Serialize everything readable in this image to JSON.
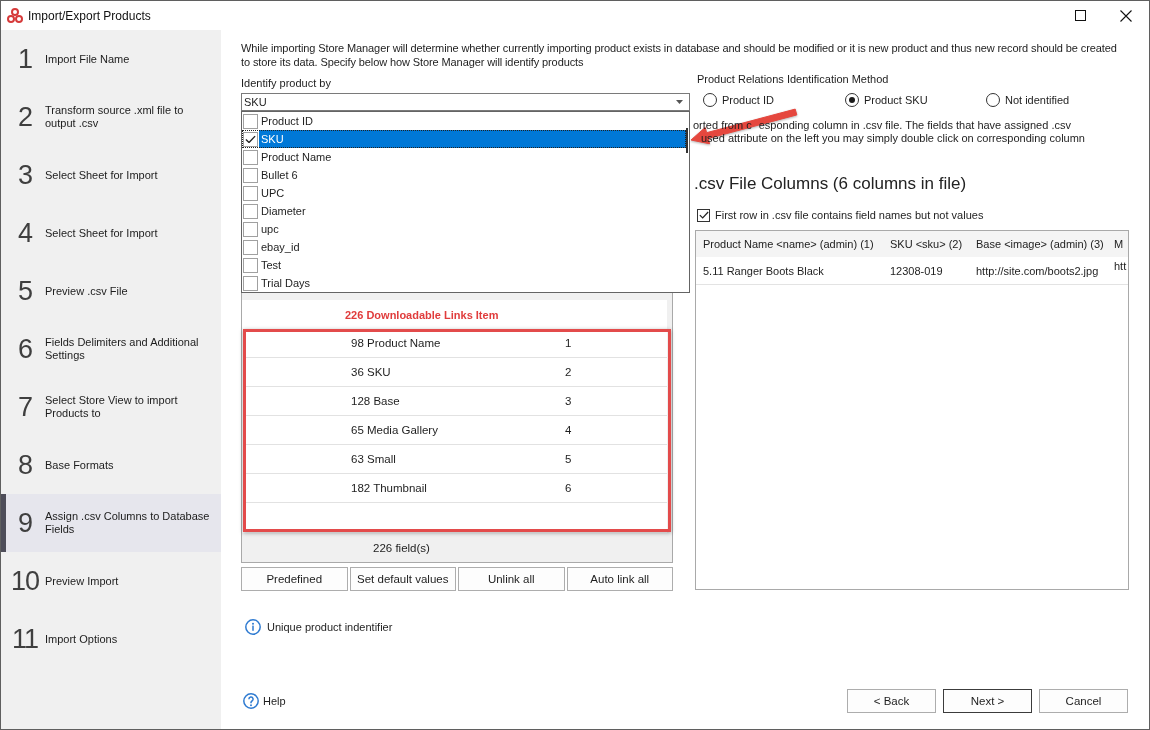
{
  "window": {
    "title": "Import/Export Products"
  },
  "sidebar": {
    "steps": [
      {
        "number": "1",
        "label": "Import File Name",
        "selected": false
      },
      {
        "number": "2",
        "label": "Transform source .xml file to output .csv",
        "selected": false
      },
      {
        "number": "3",
        "label": "Select Sheet for Import",
        "selected": false
      },
      {
        "number": "4",
        "label": "Select Sheet for Import",
        "selected": false
      },
      {
        "number": "5",
        "label": "Preview .csv File",
        "selected": false
      },
      {
        "number": "6",
        "label": "Fields Delimiters and Additional Settings",
        "selected": false
      },
      {
        "number": "7",
        "label": "Select Store View to import Products to",
        "selected": false
      },
      {
        "number": "8",
        "label": "Base Formats",
        "selected": false
      },
      {
        "number": "9",
        "label": "Assign .csv Columns to Database Fields",
        "selected": true
      },
      {
        "number": "10",
        "label": "Preview Import",
        "selected": false
      },
      {
        "number": "11",
        "label": "Import Options",
        "selected": false
      }
    ]
  },
  "intro": "While importing Store Manager will determine whether currently importing product exists in database and should be modified or it is new product and thus new record should be created to store its data. Specify below how Store Manager will identify products",
  "identify_product": {
    "label": "Identify product by",
    "value": "SKU",
    "options": [
      {
        "label": "Product ID",
        "checked": false,
        "selected": false
      },
      {
        "label": "SKU",
        "checked": true,
        "selected": true
      },
      {
        "label": "Product Name",
        "checked": false,
        "selected": false
      },
      {
        "label": "Bullet 6",
        "checked": false,
        "selected": false
      },
      {
        "label": "UPC",
        "checked": false,
        "selected": false
      },
      {
        "label": "Diameter",
        "checked": false,
        "selected": false
      },
      {
        "label": "upc",
        "checked": false,
        "selected": false
      },
      {
        "label": "ebay_id",
        "checked": false,
        "selected": false
      },
      {
        "label": "Test",
        "checked": false,
        "selected": false
      },
      {
        "label": "Trial Days",
        "checked": false,
        "selected": false
      }
    ]
  },
  "relations": {
    "title": "Product Relations Identification Method",
    "options": [
      {
        "label": "Product ID",
        "selected": false
      },
      {
        "label": "Product SKU",
        "selected": true
      },
      {
        "label": "Not identified",
        "selected": false
      }
    ]
  },
  "description_lines": [
    [
      "orted from c",
      "esponding column in .csv file. The fields that have assigned .csv"
    ],
    [
      "used attribute on the left you may simply double click on corresponding column"
    ]
  ],
  "fields_panel": {
    "group_title": "226 Downloadable Links Item",
    "rows": [
      {
        "field": "98 Product Name",
        "column": "1"
      },
      {
        "field": "36 SKU",
        "column": "2"
      },
      {
        "field": "128 Base",
        "column": "3"
      },
      {
        "field": "65 Media Gallery",
        "column": "4"
      },
      {
        "field": "63 Small",
        "column": "5"
      },
      {
        "field": "182 Thumbnail",
        "column": "6"
      }
    ],
    "count": "226 field(s)"
  },
  "csv_columns": {
    "title": ".csv File Columns (6 columns in file)",
    "first_row_names": {
      "label": "First row in .csv file contains field names but not values",
      "checked": true
    },
    "columns": [
      "Product Name <name> (admin) (1)",
      "SKU <sku> (2)",
      "Base <image> (admin) (3)",
      "M"
    ],
    "rows": [
      [
        "5.11 Ranger Boots Black",
        "12308-019",
        "http://site.com/boots2.jpg",
        "htt"
      ]
    ]
  },
  "panel_buttons": [
    "Predefined",
    "Set default values",
    "Unlink all",
    "Auto link all"
  ],
  "note": "Unique product indentifier",
  "footer": {
    "help": "Help",
    "buttons": [
      {
        "label": "< Back",
        "default": false
      },
      {
        "label": "Next >",
        "default": true
      },
      {
        "label": "Cancel",
        "default": false
      }
    ]
  }
}
